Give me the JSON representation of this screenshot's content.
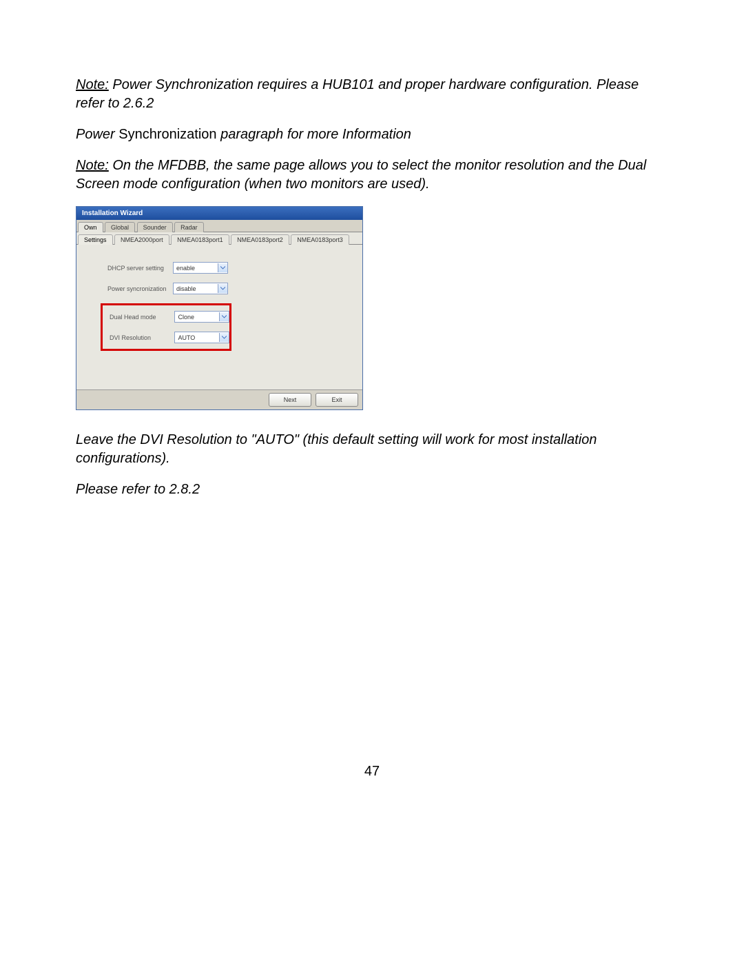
{
  "text": {
    "note1_label": "Note:",
    "note1_body": " Power Synchronization requires a HUB101 and proper hardware configuration. Please refer to 2.6.2",
    "line2_a": "Power ",
    "line2_b": "Synchronization ",
    "line2_c": "paragraph for more Information",
    "note2_label": "Note:",
    "note2_body": " On the MFDBB, the same page allows you to select the monitor resolution and the Dual Screen mode configuration (when two monitors are used).",
    "post1": "Leave the DVI Resolution to \"AUTO\" (this default setting will work for most installation configurations).",
    "post2": "Please refer to 2.8.2",
    "page_number": "47"
  },
  "wizard": {
    "title": "Installation Wizard",
    "tabs_top": [
      "Own",
      "Global",
      "Sounder",
      "Radar"
    ],
    "tabs_top_selected": 0,
    "tabs_sub": [
      "Settings",
      "NMEA2000port",
      "NMEA0183port1",
      "NMEA0183port2",
      "NMEA0183port3"
    ],
    "tabs_sub_selected": 0,
    "fields": {
      "dhcp": {
        "label": "DHCP server setting",
        "value": "enable"
      },
      "psync": {
        "label": "Power syncronization",
        "value": "disable"
      },
      "dual": {
        "label": "Dual Head mode",
        "value": "Clone"
      },
      "dvi": {
        "label": "DVI Resolution",
        "value": "AUTO"
      }
    },
    "buttons": {
      "next": "Next",
      "exit": "Exit"
    }
  }
}
